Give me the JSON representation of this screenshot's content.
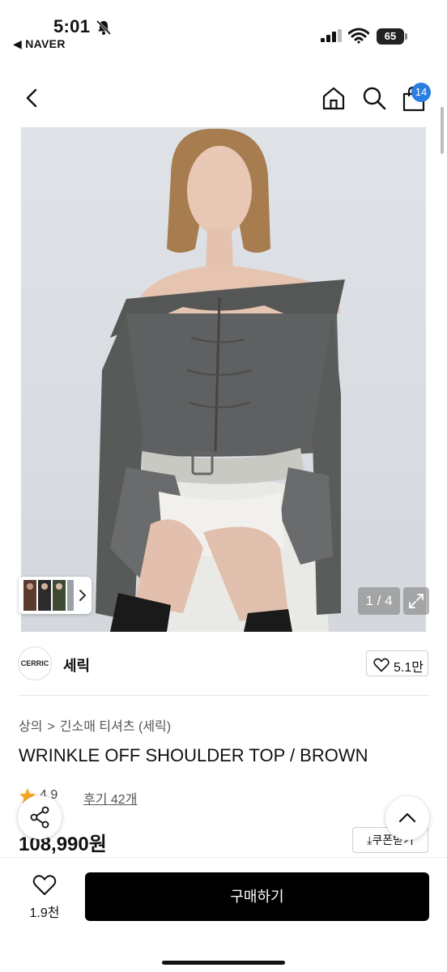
{
  "status_bar": {
    "time": "5:01",
    "back_app": "◀ NAVER",
    "battery": "65"
  },
  "nav": {
    "cart_count": "14"
  },
  "gallery": {
    "counter": "1 / 4"
  },
  "brand": {
    "logo_text": "CERRIC",
    "name": "세릭",
    "likes": "5.1만"
  },
  "breadcrumb": {
    "level1": "상의",
    "level2": "긴소매 티셔츠 (세릭)"
  },
  "product": {
    "title": "WRINKLE OFF SHOULDER TOP / BROWN",
    "rating": "4.9",
    "reviews": "후기 42개",
    "price": "108,990원",
    "coupon": "쿠폰받기"
  },
  "bottom_bar": {
    "wish_count": "1.9천",
    "buy_label": "구매하기"
  },
  "colors": {
    "badge": "#2a7de1",
    "buy_button": "#000000",
    "star": "#f5a623"
  }
}
